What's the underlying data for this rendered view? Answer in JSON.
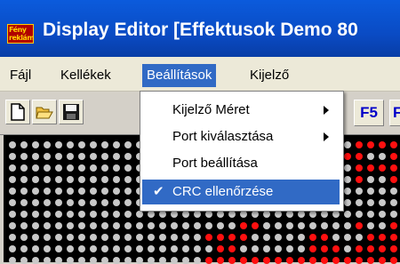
{
  "window": {
    "title": "Display Editor [Effektusok Demo 80",
    "icon_text": "Fény\nreklám"
  },
  "menubar": {
    "items": [
      {
        "label": "Fájl"
      },
      {
        "label": "Kellékek"
      },
      {
        "label": "Beállítások"
      },
      {
        "label": "Kijelző"
      }
    ]
  },
  "toolbar": {
    "f5_label": "F5",
    "f6_label": "F"
  },
  "dropdown": {
    "items": [
      {
        "label": "Kijelző Méret",
        "submenu": true
      },
      {
        "label": "Port kiválasztása",
        "submenu": true
      },
      {
        "label": "Port beállítása",
        "submenu": false
      },
      {
        "label": "CRC ellenőrzése",
        "checked": true,
        "check": "✔"
      }
    ]
  },
  "colors": {
    "led_off": "#c8c8c8",
    "led_on": "#ff1010",
    "highlight": "#316ac5"
  }
}
